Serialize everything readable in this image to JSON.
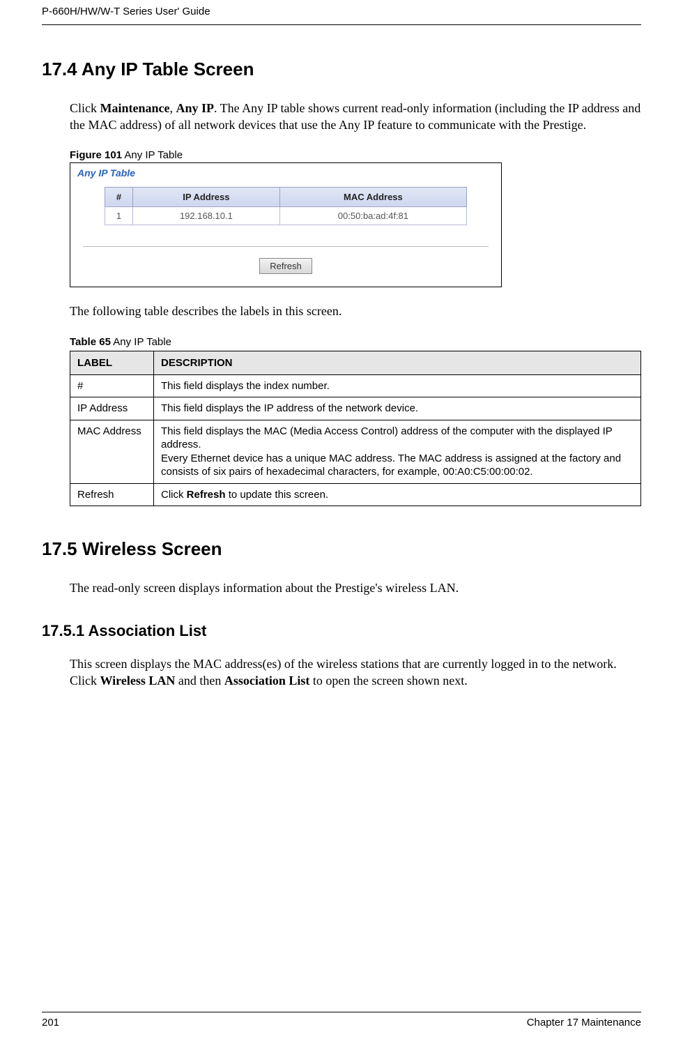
{
  "header": {
    "doc_title": "P-660H/HW/W-T Series User' Guide"
  },
  "section_174": {
    "heading": "17.4  Any IP Table Screen",
    "para1_pre": "Click ",
    "para1_b1": "Maintenance",
    "para1_mid": ", ",
    "para1_b2": "Any IP",
    "para1_post": ". The Any IP table shows current read-only information (including the IP address and the MAC address) of all network devices that use the Any IP feature to communicate with the Prestige."
  },
  "figure101": {
    "caption_bold": "Figure 101",
    "caption_rest": "   Any IP Table",
    "panel_title": "Any IP Table",
    "headers": {
      "num": "#",
      "ip": "IP Address",
      "mac": "MAC Address"
    },
    "rows": [
      {
        "num": "1",
        "ip": "192.168.10.1",
        "mac": "00:50:ba:ad:4f:81"
      }
    ],
    "refresh_label": "Refresh"
  },
  "mid_para": "The following table describes the labels in this screen.",
  "table65": {
    "caption_bold": "Table 65",
    "caption_rest": "   Any IP Table",
    "header_label": "LABEL",
    "header_desc": "DESCRIPTION",
    "rows": [
      {
        "label": "#",
        "desc": "This field displays the index number."
      },
      {
        "label": "IP Address",
        "desc": "This field displays the IP address of the network device."
      },
      {
        "label": "MAC Address",
        "desc_line1": "This field displays the MAC (Media Access Control) address of the computer with the displayed IP address.",
        "desc_line2": "Every Ethernet device has a unique MAC address. The MAC address is assigned at the factory and consists of six pairs of hexadecimal characters, for example, 00:A0:C5:00:00:02."
      },
      {
        "label": "Refresh",
        "desc_pre": "Click ",
        "desc_b": "Refresh",
        "desc_post": " to update this screen."
      }
    ]
  },
  "section_175": {
    "heading": "17.5  Wireless Screen",
    "para": "The read-only screen displays information about the Prestige's wireless LAN."
  },
  "section_1751": {
    "heading": "17.5.1  Association List",
    "para_pre": "This screen displays the MAC address(es) of the wireless stations that are currently logged in to the network. Click ",
    "para_b1": "Wireless LAN",
    "para_mid": " and then ",
    "para_b2": "Association List",
    "para_post": " to open the screen shown next."
  },
  "footer": {
    "page": "201",
    "chapter": "Chapter 17 Maintenance"
  }
}
